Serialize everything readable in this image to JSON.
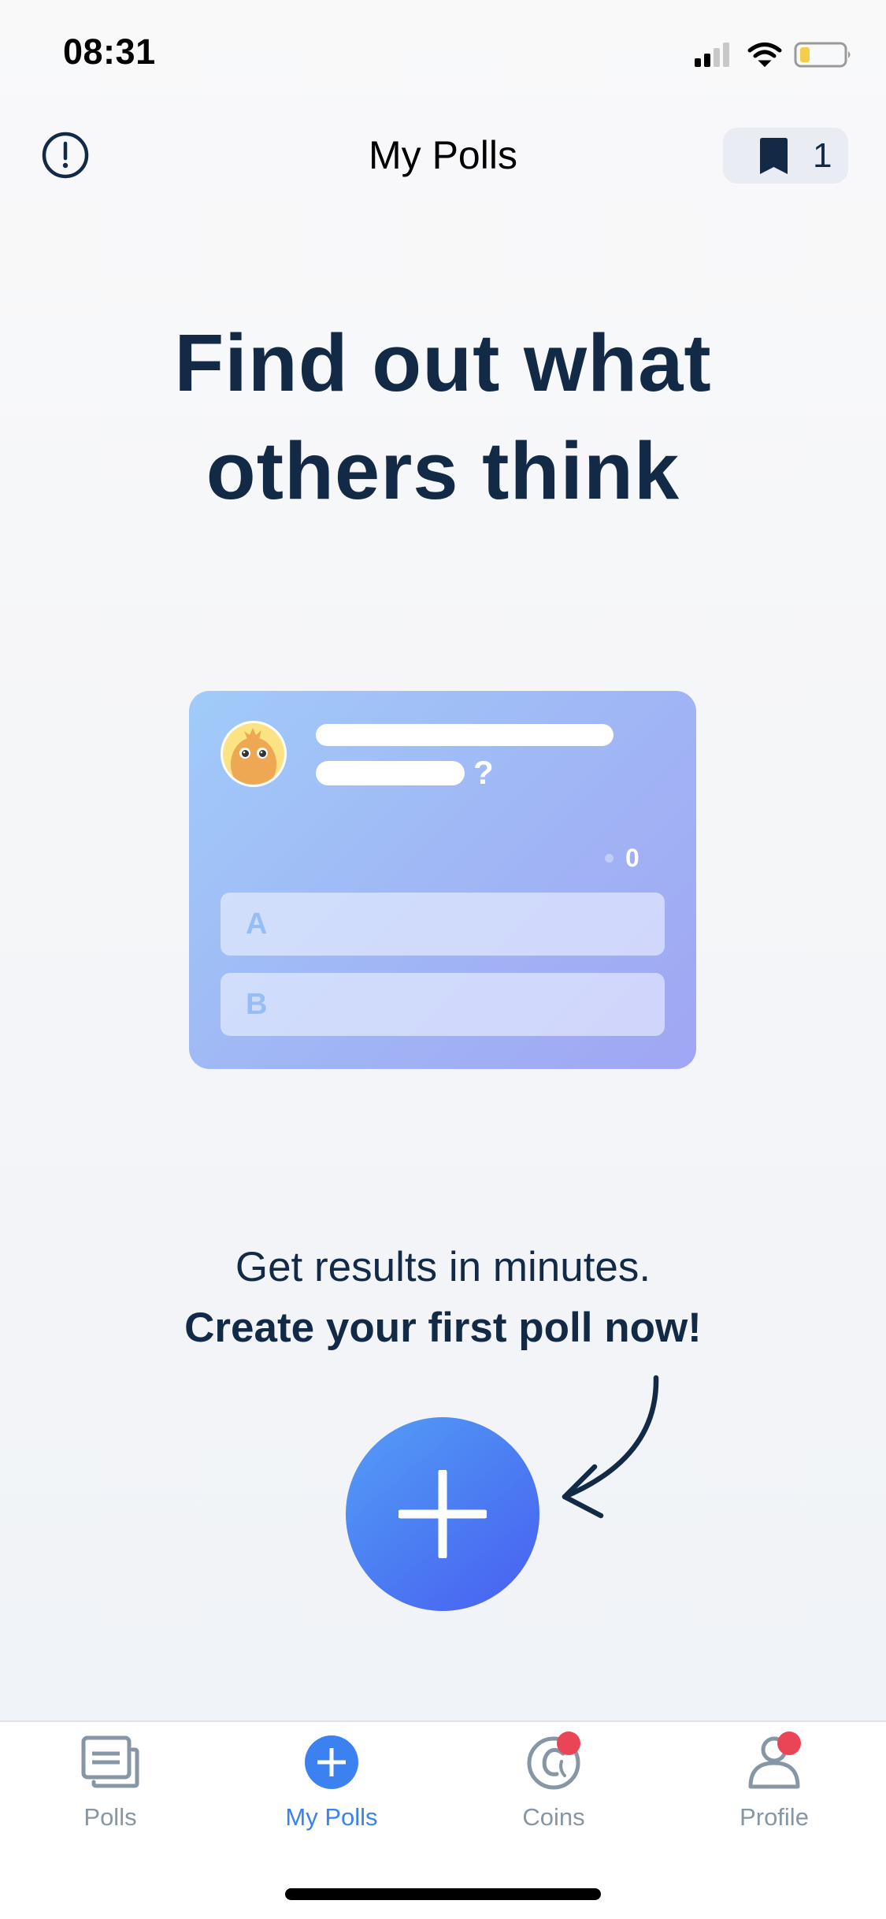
{
  "status_bar": {
    "time": "08:31",
    "signal_bars_active": 2,
    "signal_bars_total": 4,
    "battery_level": 0.2,
    "battery_color": "#f6cd4a"
  },
  "nav": {
    "info_icon": "info-circle-icon",
    "title": "My Polls",
    "bookmark_icon": "bookmark-icon",
    "bookmark_count": "1"
  },
  "headline": {
    "line1": "Find out what",
    "line2": "others think"
  },
  "sample_card": {
    "question_mark": "?",
    "vote_count": "0",
    "options": [
      {
        "letter": "A"
      },
      {
        "letter": "B"
      }
    ],
    "gradient": [
      "#a0cbf9",
      "#a0a6f4"
    ]
  },
  "cta": {
    "line1": "Get results in minutes.",
    "line2": "Create your first poll now!",
    "button_icon": "plus-icon",
    "button_gradient": [
      "#549ef7",
      "#4a5ff2"
    ]
  },
  "tabbar": {
    "active_color": "#3b82f0",
    "inactive_color": "#8796a4",
    "badge_color": "#ea4556",
    "tabs": [
      {
        "label": "Polls",
        "icon": "polls-stack-icon",
        "active": false,
        "badge": false
      },
      {
        "label": "My Polls",
        "icon": "plus-circle-icon",
        "active": true,
        "badge": false
      },
      {
        "label": "Coins",
        "icon": "coin-icon",
        "active": false,
        "badge": true
      },
      {
        "label": "Profile",
        "icon": "person-icon",
        "active": false,
        "badge": true
      }
    ]
  }
}
